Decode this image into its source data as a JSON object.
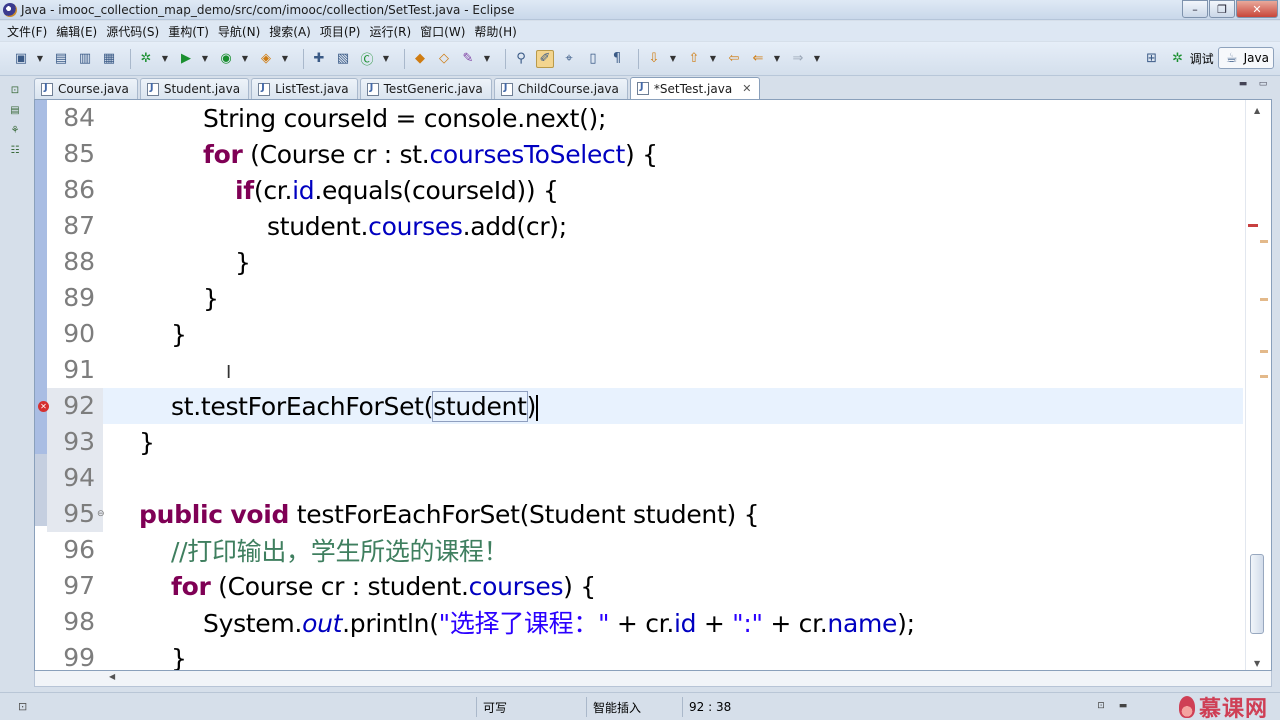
{
  "window": {
    "title": "Java - imooc_collection_map_demo/src/com/imooc/collection/SetTest.java - Eclipse",
    "controls": [
      "–",
      "❐",
      "✕"
    ]
  },
  "menu": [
    "文件(F)",
    "编辑(E)",
    "源代码(S)",
    "重构(T)",
    "导航(N)",
    "搜索(A)",
    "项目(P)",
    "运行(R)",
    "窗口(W)",
    "帮助(H)"
  ],
  "toolbar": {
    "debug_perspective_label": "调试",
    "java_perspective_label": "Java"
  },
  "tabs": [
    {
      "label": "Course.java"
    },
    {
      "label": "Student.java"
    },
    {
      "label": "ListTest.java"
    },
    {
      "label": "TestGeneric.java"
    },
    {
      "label": "ChildCourse.java"
    },
    {
      "label": "*SetTest.java",
      "active": true,
      "close": "✕"
    }
  ],
  "editor": {
    "line_numbers": [
      "84",
      "85",
      "86",
      "87",
      "88",
      "89",
      "90",
      "91",
      "92",
      "93",
      "94",
      "95",
      "96",
      "97",
      "98",
      "99"
    ],
    "current_line": "92"
  },
  "code": {
    "l84": "String courseId = console.next();",
    "l85_kw": "for",
    "l85_a": " (Course cr : st.",
    "l85_f": "coursesToSelect",
    "l85_b": ") {",
    "l86_kw": "if",
    "l86_a": "(cr.",
    "l86_f": "id",
    "l86_b": ".equals(courseId)) {",
    "l87_a": "student.",
    "l87_f": "courses",
    "l87_b": ".add(cr);",
    "l88": "}",
    "l89": "}",
    "l90": "}",
    "l92_a": "st.testForEachForSet(",
    "l92_arg": "student",
    "l92_b": ")",
    "l93": "}",
    "l95_kw1": "public",
    "l95_kw2": "void",
    "l95_a": " testForEachForSet(Student student) {",
    "l96": "//打印输出，学生所选的课程！",
    "l97_kw": "for",
    "l97_a": " (Course cr : student.",
    "l97_f": "courses",
    "l97_b": ") {",
    "l98_a": "System.",
    "l98_out": "out",
    "l98_b": ".println(",
    "l98_s1": "\"选择了课程：\"",
    "l98_c": " + cr.",
    "l98_f1": "id",
    "l98_d": " + ",
    "l98_s2": "\":\"",
    "l98_e": " + cr.",
    "l98_f2": "name",
    "l98_g": ");",
    "l99": "}"
  },
  "status": {
    "writable": "可写",
    "insert_mode": "智能插入",
    "position": "92 : 38",
    "watermark": "慕课网"
  },
  "colors": {
    "keyword": "#7f0055",
    "field": "#0000c0",
    "string": "#2a00ff",
    "comment": "#3f7f5f",
    "current_line": "#e8f2fe"
  }
}
